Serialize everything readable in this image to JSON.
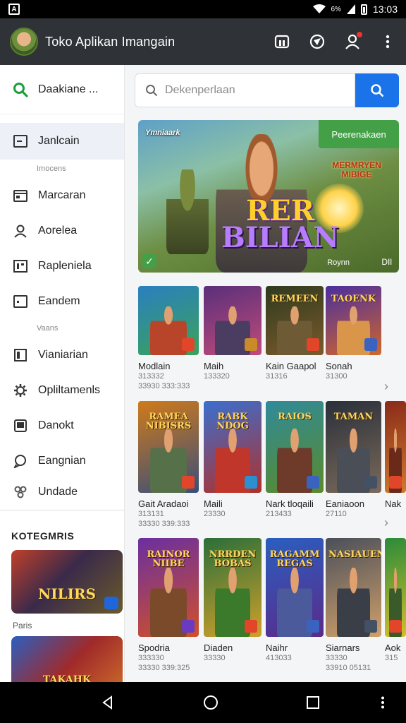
{
  "status_bar": {
    "signal": "6%",
    "time": "13:03"
  },
  "app_bar": {
    "title": "Toko Aplikan Imangain"
  },
  "sidebar": {
    "search_label": "Daakiane ...",
    "items": [
      {
        "label": "Janlcain",
        "icon": "window-icon",
        "active": true
      },
      {
        "label": "Marcaran",
        "icon": "calendar-icon"
      },
      {
        "label": "Aorelea",
        "icon": "person-icon"
      },
      {
        "label": "Rapleniela",
        "icon": "grid-icon"
      },
      {
        "label": "Eandem",
        "icon": "square-icon"
      },
      {
        "label": "Vianiarian",
        "icon": "panel-icon"
      },
      {
        "label": "Opliltamenls",
        "icon": "gear-icon"
      },
      {
        "label": "Danokt",
        "icon": "tile-icon"
      },
      {
        "label": "Eangnian",
        "icon": "chat-icon"
      },
      {
        "label": "Undade",
        "icon": "cog-cluster-icon"
      }
    ],
    "sub_labels": [
      "Imocens",
      "Vaans"
    ],
    "category_title": "KOTEGMRIS",
    "categories": [
      {
        "label": "Paris",
        "art_text": "NILIRS"
      },
      {
        "label": "",
        "art_text": "TAKAHK"
      }
    ]
  },
  "search": {
    "placeholder": "Dekenperlaan"
  },
  "hero": {
    "brand": "Ymniaark",
    "cta": "Peerenakaen",
    "logo_text": "MERMRYEN MIBIGE",
    "title_line1": "RER",
    "title_line2": "BILIAN",
    "corner_left": "Roynn",
    "corner_right": "DIl"
  },
  "rows": [
    {
      "tiles": [
        {
          "name": "Modlain",
          "meta1": "313332",
          "meta2": "33930 333:333",
          "art_text": "",
          "colors": [
            "#2a7fbf",
            "#3aa35a"
          ],
          "fig": "#b8452a",
          "mini": "#e2462a"
        },
        {
          "name": "Maih",
          "meta1": "133320",
          "meta2": "",
          "art_text": "",
          "colors": [
            "#5a2f7a",
            "#c04b7a"
          ],
          "fig": "#4b3c62",
          "mini": "#c98a2a"
        },
        {
          "name": "Kain Gaapol",
          "meta1": "31316",
          "meta2": "",
          "art_text": "REMEEN",
          "colors": [
            "#2f3a1f",
            "#7a5a2a"
          ],
          "fig": "#6f5a36",
          "mini": "#e2462a"
        },
        {
          "name": "Sonah",
          "meta1": "31300",
          "meta2": "",
          "art_text": "TAOENK",
          "colors": [
            "#4a2ea0",
            "#d0662a"
          ],
          "fig": "#d9964a",
          "mini": "#3a63c0"
        }
      ]
    },
    {
      "tiles": [
        {
          "name": "Gait Aradaoi",
          "meta1": "313131",
          "meta2": "33330 339:333",
          "art_text": "RAMEA NIBISRS",
          "colors": [
            "#d07a1a",
            "#3a4f7a"
          ],
          "fig": "#56704a",
          "mini": "#e2462a"
        },
        {
          "name": "Maili",
          "meta1": "23330",
          "meta2": "",
          "art_text": "RABK NDOG",
          "colors": [
            "#3a6fd0",
            "#b0302a"
          ],
          "fig": "#c0362a",
          "mini": "#2b8fd0"
        },
        {
          "name": "Nark tloqaili",
          "meta1": "213433",
          "meta2": "",
          "art_text": "RAIOS",
          "colors": [
            "#2f8a9a",
            "#5a8a2a"
          ],
          "fig": "#6e3a2a",
          "mini": "#3a63c0"
        },
        {
          "name": "Eaniaoon",
          "meta1": "27110",
          "meta2": "",
          "art_text": "TAMAN",
          "colors": [
            "#2a2f3a",
            "#7a6a5a"
          ],
          "fig": "#4a4e57",
          "mini": "#445064"
        },
        {
          "name": "Nak",
          "meta1": "",
          "meta2": "",
          "art_text": "",
          "colors": [
            "#8a2a1a",
            "#d07a2a"
          ],
          "fig": "#6a2a1a",
          "mini": "#e2462a"
        }
      ]
    },
    {
      "tiles": [
        {
          "name": "Spodria",
          "meta1": "333330",
          "meta2": "33330 339:325",
          "art_text": "RAINOR NIIBE",
          "colors": [
            "#6a2fa0",
            "#d0502a"
          ],
          "fig": "#7a4a2a",
          "mini": "#6a3ac0"
        },
        {
          "name": "Diaden",
          "meta1": "33330",
          "meta2": "",
          "art_text": "NRRDEN BOBAS",
          "colors": [
            "#2a6f3a",
            "#d0a02a"
          ],
          "fig": "#3a7a2a",
          "mini": "#e2462a"
        },
        {
          "name": "Naihr",
          "meta1": "413033",
          "meta2": "",
          "art_text": "RAGAMM REGAS",
          "colors": [
            "#2a5fc0",
            "#5a2a8a"
          ],
          "fig": "#4a5a9a",
          "mini": "#3a63c0"
        },
        {
          "name": "Siarnars",
          "meta1": "33330",
          "meta2": "33910 05131",
          "art_text": "NASIAUEN",
          "colors": [
            "#4a4f5a",
            "#d0a06a"
          ],
          "fig": "#3a3e47",
          "mini": "#445064"
        },
        {
          "name": "Aok",
          "meta1": "315",
          "meta2": "",
          "art_text": "",
          "colors": [
            "#2a8a3a",
            "#d0c02a"
          ],
          "fig": "#3a5a2a",
          "mini": "#e2462a"
        }
      ]
    }
  ]
}
